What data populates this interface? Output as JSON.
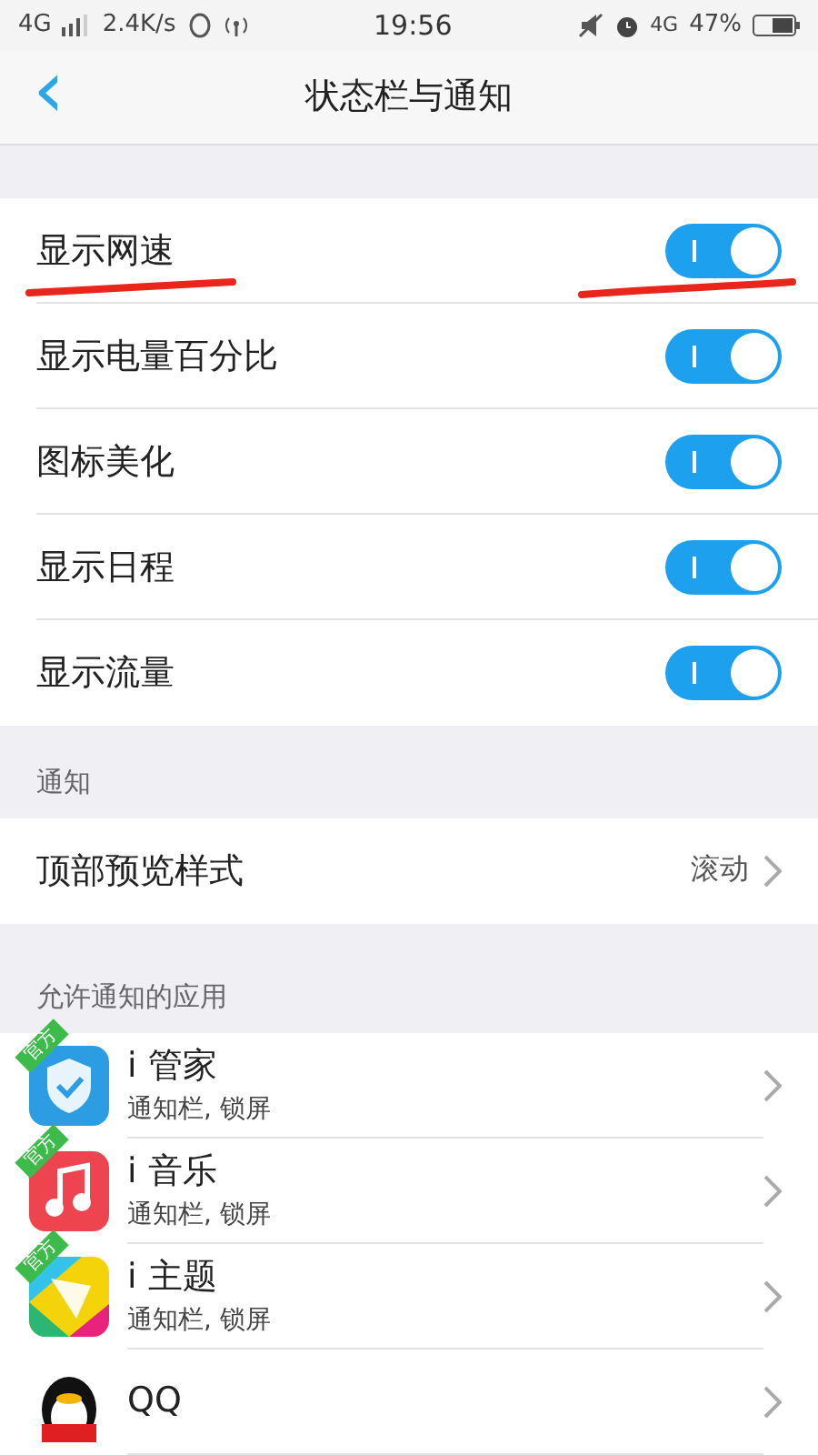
{
  "status_bar": {
    "network": "4G",
    "speed": "2.4K/s",
    "time": "19:56",
    "data_network": "4G",
    "battery": "47%"
  },
  "header": {
    "back": "‹",
    "title": "状态栏与通知"
  },
  "toggles": [
    {
      "label": "显示网速",
      "on": true,
      "underlined": true
    },
    {
      "label": "显示电量百分比",
      "on": true,
      "underlined": false
    },
    {
      "label": "图标美化",
      "on": true,
      "underlined": false
    },
    {
      "label": "显示日程",
      "on": true,
      "underlined": false
    },
    {
      "label": "显示流量",
      "on": true,
      "underlined": false
    }
  ],
  "notification_section": {
    "title": "通知",
    "rows": [
      {
        "label": "顶部预览样式",
        "value": "滚动"
      }
    ]
  },
  "apps_section": {
    "title": "允许通知的应用",
    "apps": [
      {
        "name": "i 管家",
        "detail": "通知栏, 锁屏",
        "badge": "官方",
        "kind": "shield"
      },
      {
        "name": "i 音乐",
        "detail": "通知栏, 锁屏",
        "badge": "官方",
        "kind": "music"
      },
      {
        "name": "i 主题",
        "detail": "通知栏, 锁屏",
        "badge": "官方",
        "kind": "theme"
      },
      {
        "name": "QQ",
        "kind": "penguin"
      }
    ]
  }
}
